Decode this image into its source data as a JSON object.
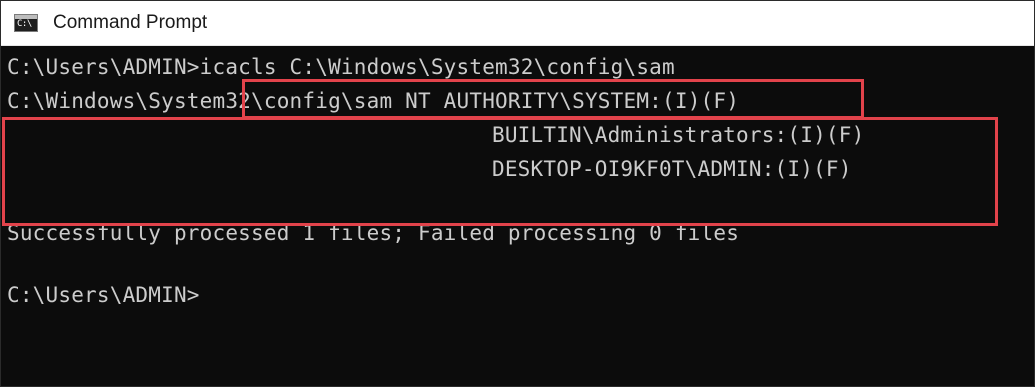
{
  "window": {
    "title": "Command Prompt",
    "icon": "cmd-icon",
    "icon_glyph": "C:\\"
  },
  "console": {
    "prompt_1": "C:\\Users\\ADMIN>",
    "command": "icacls C:\\Windows\\System32\\config\\sam",
    "acl_file": "C:\\Windows\\System32\\config\\sam",
    "acl_entries": [
      "NT AUTHORITY\\SYSTEM:(I)(F)",
      "BUILTIN\\Administrators:(I)(F)",
      "DESKTOP-OI9KF0T\\ADMIN:(I)(F)"
    ],
    "summary": "Successfully processed 1 files; Failed processing 0 files",
    "prompt_2": "C:\\Users\\ADMIN>"
  },
  "highlight_color": "#e2434b",
  "background_color": "#0c0c0c",
  "text_color": "#cccccc"
}
